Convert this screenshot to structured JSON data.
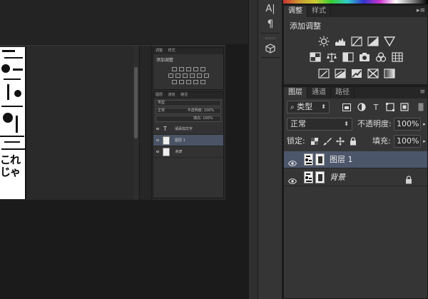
{
  "tool_strip": {
    "icons": [
      "character-icon",
      "paragraph-icon",
      "3d-icon"
    ],
    "character_glyph": "A|",
    "paragraph_glyph": "¶"
  },
  "adjustments_panel": {
    "tabs": [
      {
        "label": "调整",
        "active": true
      },
      {
        "label": "样式",
        "active": false
      }
    ],
    "title": "添加调整",
    "row1_icons": [
      "brightness-icon",
      "levels-icon",
      "curves-icon",
      "exposure-icon",
      "vibrance-icon"
    ],
    "row2_icons": [
      "hue-saturation-icon",
      "color-balance-icon",
      "black-white-icon",
      "photo-filter-icon",
      "channel-mixer-icon",
      "color-lookup-icon"
    ],
    "row3_icons": [
      "invert-icon",
      "posterize-icon",
      "threshold-icon",
      "selective-color-icon",
      "gradient-map-icon"
    ]
  },
  "layers_panel": {
    "tabs": [
      {
        "label": "图层",
        "active": true
      },
      {
        "label": "通道",
        "active": false
      },
      {
        "label": "路径",
        "active": false
      }
    ],
    "filter_kind": "类型",
    "blend_mode": "正常",
    "opacity_label": "不透明度:",
    "opacity_value": "100%",
    "lock_label": "锁定:",
    "fill_label": "填充:",
    "fill_value": "100%",
    "layers": [
      {
        "name": "图层 1",
        "selected": true,
        "locked": false
      },
      {
        "name": "背景",
        "selected": false,
        "locked": true
      }
    ]
  },
  "document": {
    "manga_text": "これじゃ"
  },
  "mini_preview": {
    "tabs": [
      "调整",
      "样式"
    ],
    "title": "添加调整",
    "layer_tabs": [
      "图层",
      "通道",
      "路径"
    ],
    "filter_kind": "类型",
    "blend_mode": "正常",
    "opacity_label": "不透明度:",
    "opacity_value": "100%",
    "fill_label": "填充:",
    "fill_value": "100%",
    "layers": [
      {
        "name": "请添加文字",
        "type": "text"
      },
      {
        "name": "图层 1",
        "type": "image",
        "selected": true
      },
      {
        "name": "背景",
        "type": "image"
      }
    ]
  },
  "colors": {
    "selected_layer": "#4c566b",
    "panel_bg": "#353535",
    "tab_bg": "#262626"
  }
}
